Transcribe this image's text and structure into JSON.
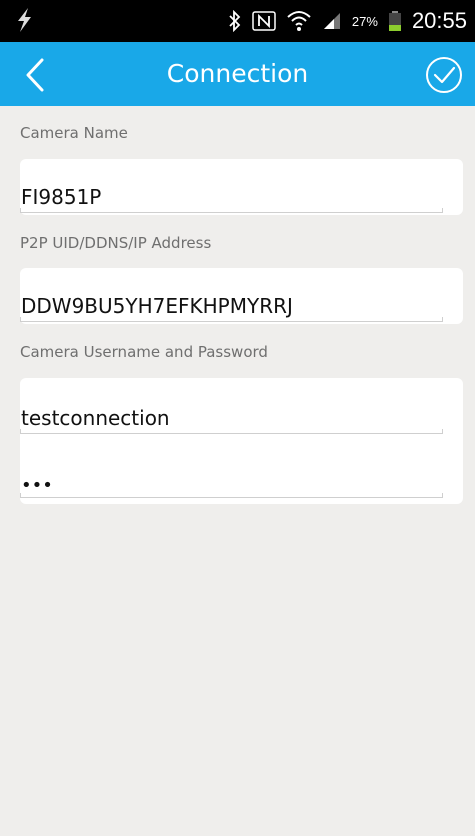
{
  "status_bar": {
    "battery": "27%",
    "time": "20:55",
    "icons": [
      "flash-icon",
      "bluetooth-icon",
      "nfc-icon",
      "wifi-icon",
      "signal-icon",
      "battery-icon"
    ]
  },
  "header": {
    "title": "Connection",
    "back_icon": "chevron-left-icon",
    "confirm_icon": "check-circle-icon"
  },
  "camera_name": {
    "label": "Camera Name",
    "value": "FI9851P"
  },
  "address": {
    "label": "P2P UID/DDNS/IP Address",
    "value": "DDW9BU5YH7EFKHPMYRRJ"
  },
  "credentials": {
    "label": "Camera Username and Password",
    "username": "testconnection",
    "password": "•••"
  },
  "colors": {
    "accent": "#19a8e8",
    "background": "#efeeec",
    "status_bar": "#000000"
  }
}
